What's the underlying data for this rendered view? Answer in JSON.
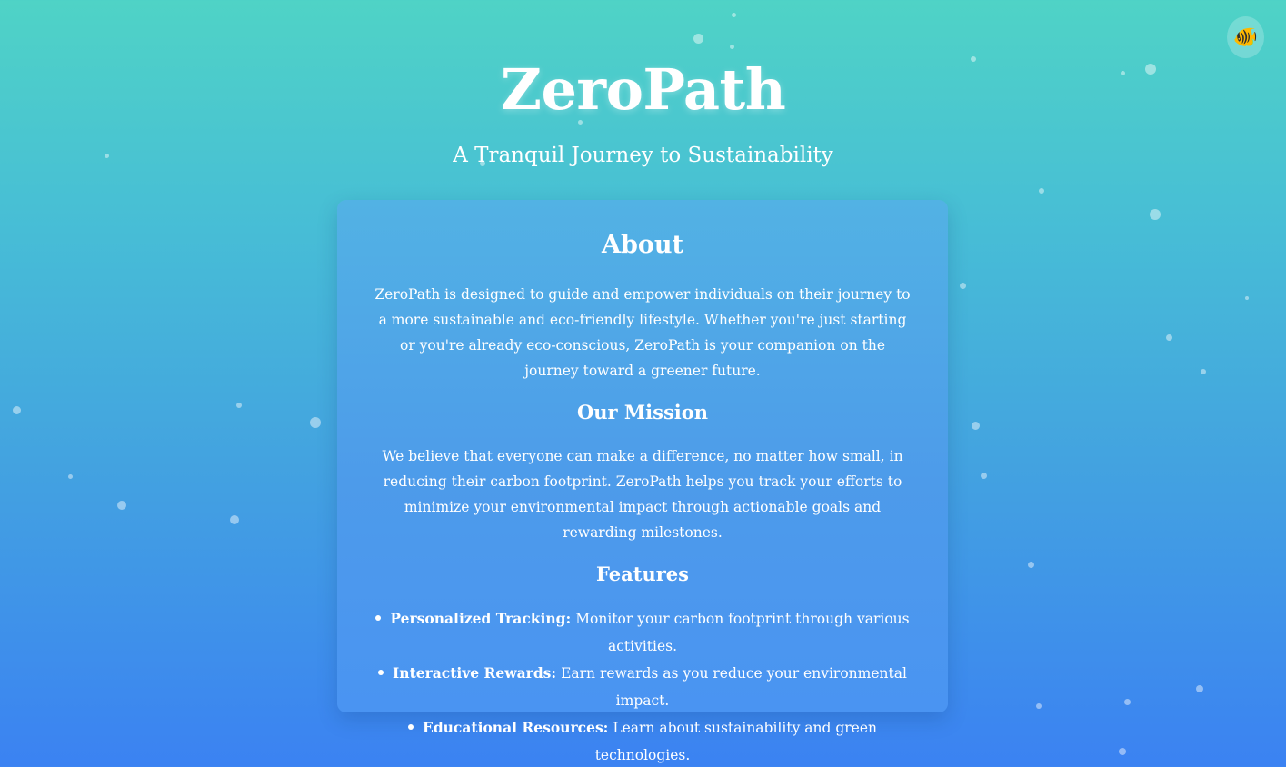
{
  "header": {
    "title": "ZeroPath",
    "subtitle": "A Tranquil Journey to Sustainability"
  },
  "toggle": {
    "icon": "fish-icon",
    "glyph": "🐠"
  },
  "about": {
    "heading": "About",
    "text": "ZeroPath is designed to guide and empower individuals on their journey to a more sustainable and eco-friendly lifestyle. Whether you're just starting or you're already eco-conscious, ZeroPath is your companion on the journey toward a greener future."
  },
  "mission": {
    "heading": "Our Mission",
    "text": "We believe that everyone can make a difference, no matter how small, in reducing their carbon footprint. ZeroPath helps you track your efforts to minimize your environmental impact through actionable goals and rewarding milestones."
  },
  "features": {
    "heading": "Features",
    "items": [
      {
        "label": "Personalized Tracking:",
        "text": "Monitor your carbon footprint through various activities."
      },
      {
        "label": "Interactive Rewards:",
        "text": "Earn rewards as you reduce your environmental impact."
      },
      {
        "label": "Educational Resources:",
        "text": "Learn about sustainability and green technologies."
      }
    ]
  },
  "colors": {
    "bg_top": "#4fd3c6",
    "bg_bottom": "#3b82f2",
    "card": "#4d9bea",
    "text": "#ffffff"
  }
}
